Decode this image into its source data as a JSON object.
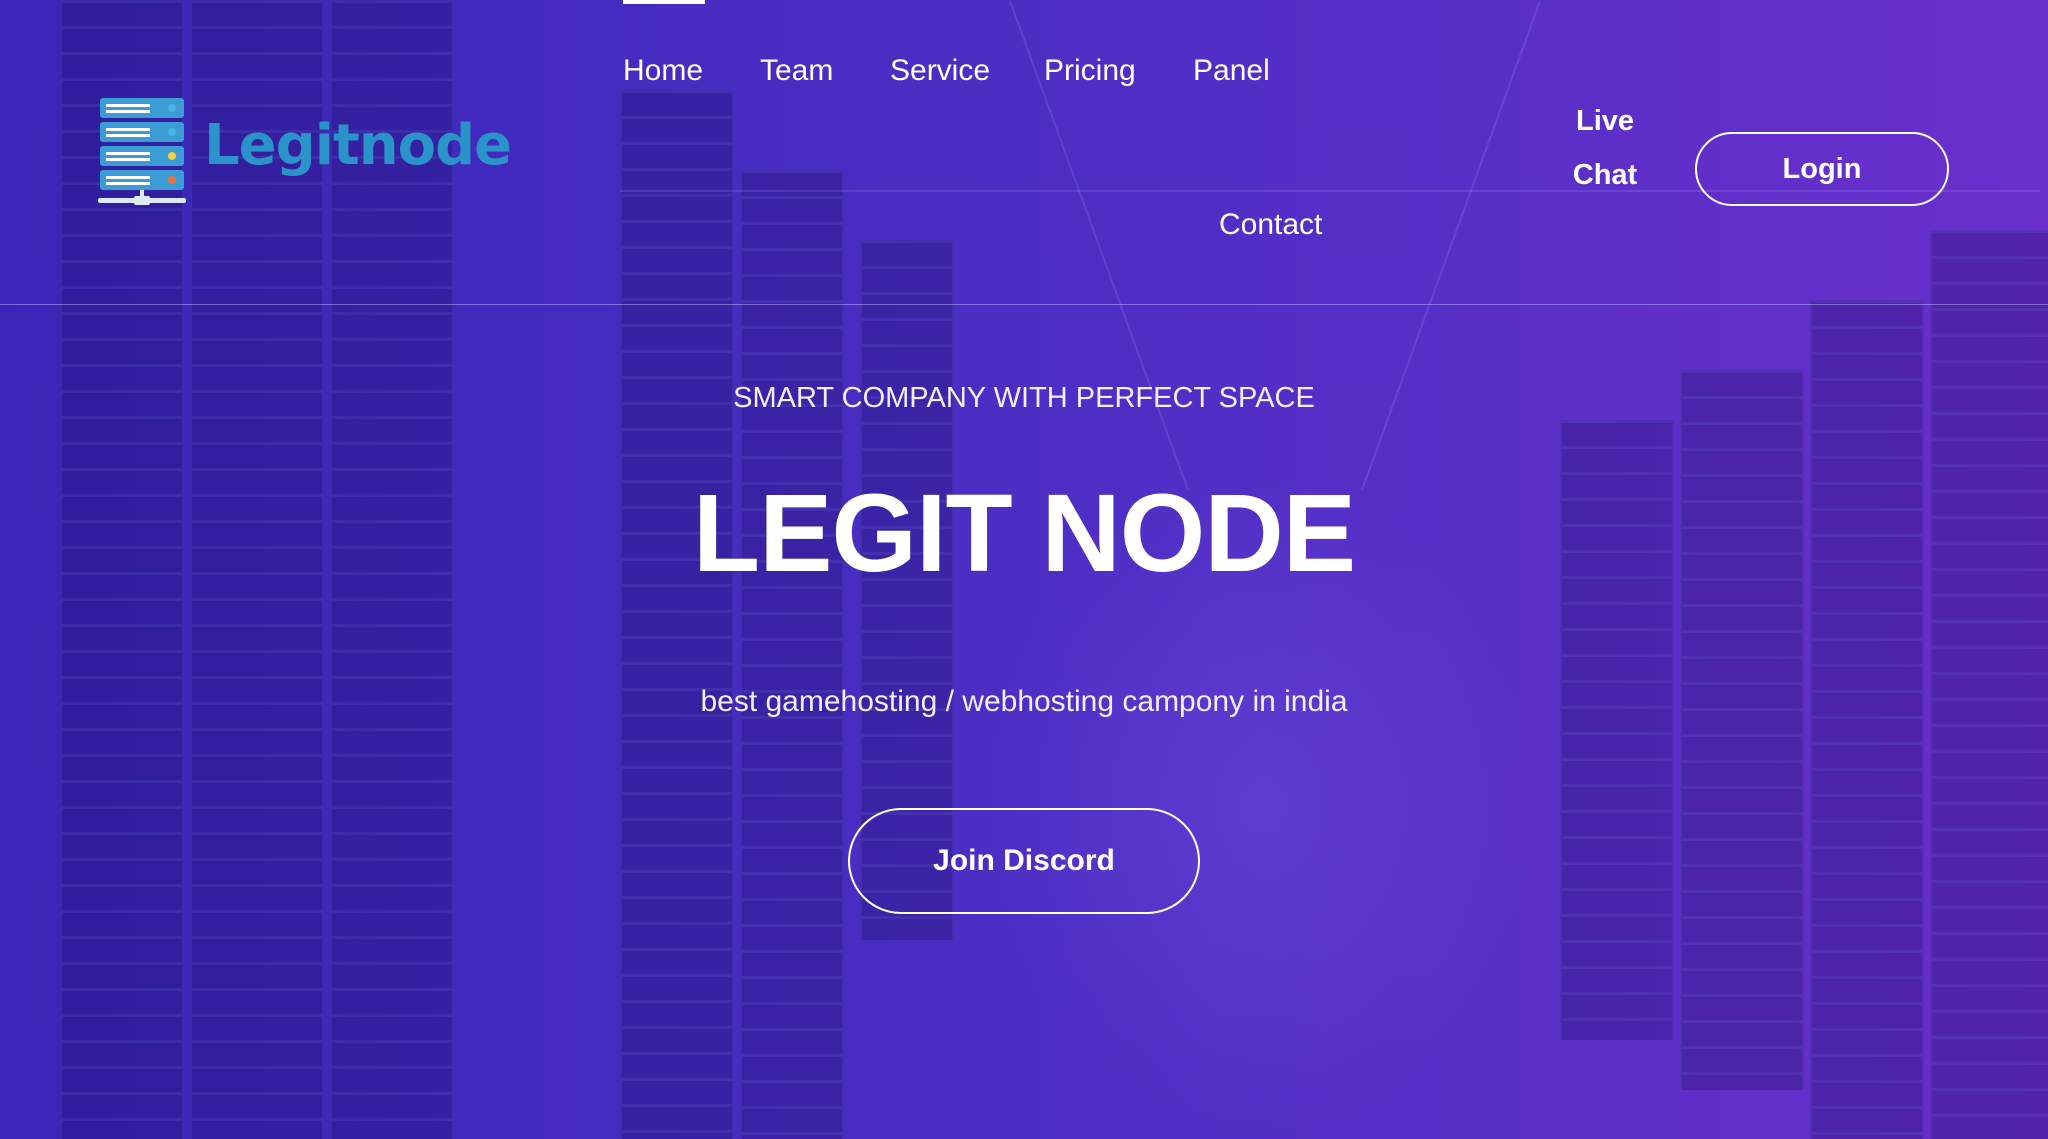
{
  "brand": {
    "name": "Legitnode",
    "colors": {
      "logo_text": "#2a93c9",
      "server_blue": "#3a9bd5",
      "led_blue": "#43b8ea",
      "led_yellow": "#f4d03f",
      "led_orange": "#e8743b"
    }
  },
  "nav": {
    "items": [
      {
        "label": "Home",
        "active": true
      },
      {
        "label": "Team"
      },
      {
        "label": "Service"
      },
      {
        "label": "Pricing"
      },
      {
        "label": "Panel"
      },
      {
        "label": "Contact"
      }
    ],
    "live_chat_line1": "Live",
    "live_chat_line2": "Chat",
    "login_label": "Login"
  },
  "hero": {
    "tagline": "SMART COMPANY WITH PERFECT SPACE",
    "title": "LEGIT NODE",
    "subtitle": "best gamehosting / webhosting campony in india",
    "cta_label": "Join Discord"
  },
  "theme": {
    "gradient_start": "#3a25b8",
    "gradient_end": "#6a2fcc",
    "text": "#ffffff"
  }
}
